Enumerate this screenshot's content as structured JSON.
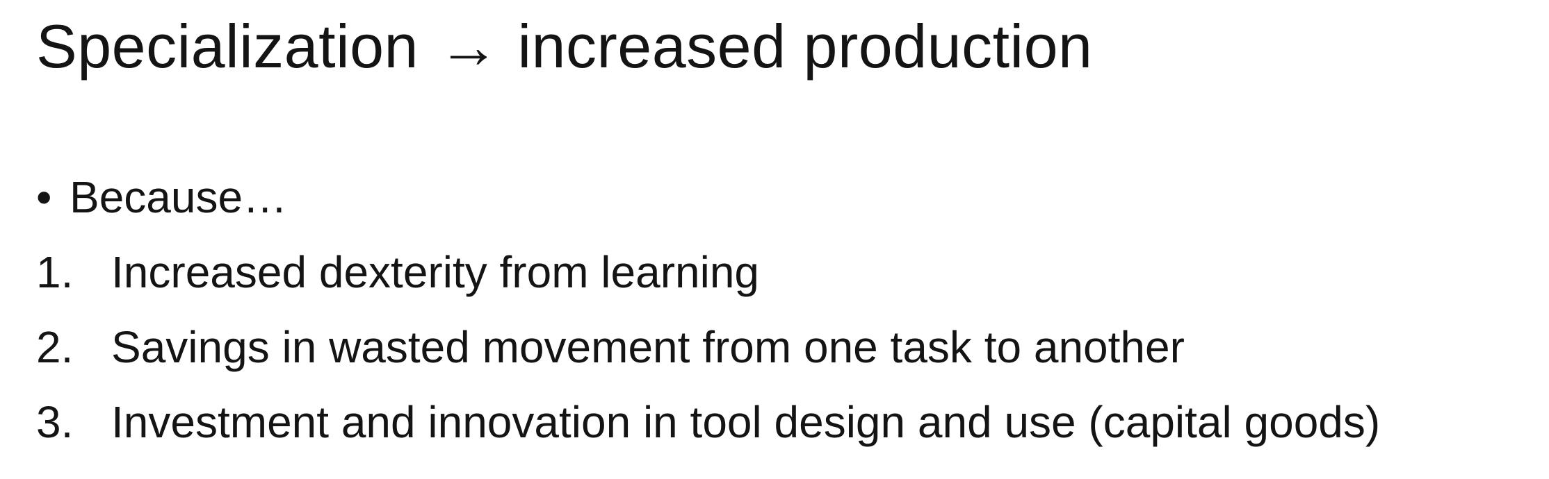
{
  "slide": {
    "title": {
      "left": "Specialization",
      "arrow": "→",
      "right": "increased production"
    },
    "intro_bullet": {
      "marker": "•",
      "text": "Because…"
    },
    "items": [
      {
        "number": "1.",
        "text": "Increased dexterity from learning"
      },
      {
        "number": "2.",
        "text": "Savings in wasted movement from one task to another"
      },
      {
        "number": "3.",
        "text": "Investment and innovation in tool design and use (capital goods)"
      }
    ]
  }
}
